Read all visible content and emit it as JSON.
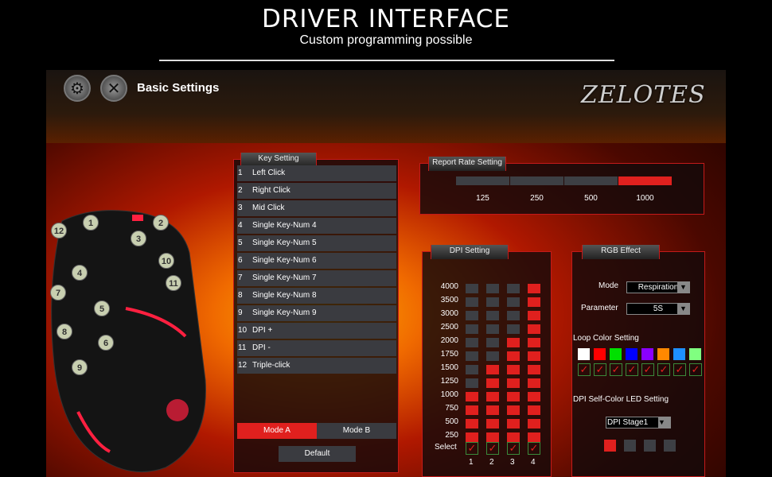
{
  "header": {
    "title": "DRIVER INTERFACE",
    "subtitle": "Custom programming possible"
  },
  "app": {
    "section": "Basic Settings",
    "logo": "ZELOTES"
  },
  "key_setting": {
    "title": "Key Setting",
    "keys": [
      {
        "n": "1",
        "label": "Left Click"
      },
      {
        "n": "2",
        "label": "Right Click"
      },
      {
        "n": "3",
        "label": "Mid Click"
      },
      {
        "n": "4",
        "label": "Single Key-Num 4"
      },
      {
        "n": "5",
        "label": "Single Key-Num 5"
      },
      {
        "n": "6",
        "label": "Single Key-Num 6"
      },
      {
        "n": "7",
        "label": "Single Key-Num 7"
      },
      {
        "n": "8",
        "label": "Single Key-Num 8"
      },
      {
        "n": "9",
        "label": "Single Key-Num 9"
      },
      {
        "n": "10",
        "label": "DPI +"
      },
      {
        "n": "11",
        "label": "DPI -"
      },
      {
        "n": "12",
        "label": "Triple-click"
      }
    ],
    "mode_a": "Mode A",
    "mode_b": "Mode B",
    "active_mode": "Mode A",
    "default": "Default"
  },
  "report_rate": {
    "title": "Report Rate Setting",
    "options": [
      "125",
      "250",
      "500",
      "1000"
    ],
    "selected": "1000"
  },
  "dpi": {
    "title": "DPI Setting",
    "levels": [
      "4000",
      "3500",
      "3000",
      "2500",
      "2000",
      "1750",
      "1500",
      "1250",
      "1000",
      "750",
      "500",
      "250"
    ],
    "stages": [
      {
        "n": "1",
        "value": "1000"
      },
      {
        "n": "2",
        "value": "1500"
      },
      {
        "n": "3",
        "value": "2000"
      },
      {
        "n": "4",
        "value": "4000"
      }
    ],
    "select_label": "Select"
  },
  "rgb": {
    "title": "RGB Effect",
    "mode_label": "Mode",
    "mode_value": "Respiration",
    "param_label": "Parameter",
    "param_value": "5S",
    "loop_title": "Loop Color Setting",
    "loop_colors": [
      "#ffffff",
      "#ff0000",
      "#00e000",
      "#0000ff",
      "#8a00ff",
      "#ff8800",
      "#1e90ff",
      "#80ff80"
    ],
    "dpi_led_title": "DPI Self-Color LED Setting",
    "dpi_stage_value": "DPI Stage1",
    "stage_colors": [
      "#e0201e",
      "#3d3f44",
      "#3d3f44",
      "#3d3f44"
    ]
  },
  "colors": {
    "accent": "#e0201e",
    "inactive": "#3d3f44"
  },
  "mouse_buttons": [
    "1",
    "2",
    "3",
    "4",
    "5",
    "6",
    "7",
    "8",
    "9",
    "10",
    "11",
    "12"
  ]
}
